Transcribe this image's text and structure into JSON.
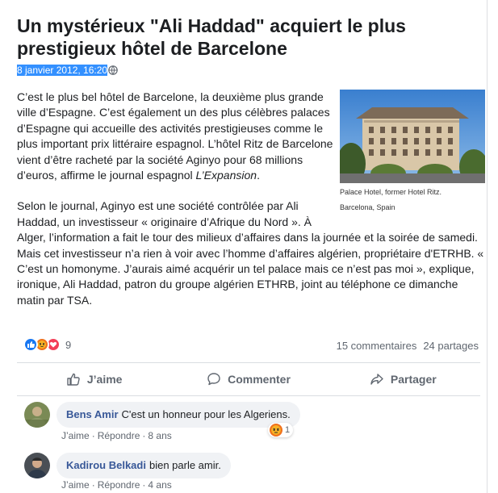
{
  "article": {
    "title": "Un mystérieux \"Ali Haddad\" acquiert le plus prestigieux hôtel de Barcelone",
    "date": "8 janvier 2012, 16:20",
    "paragraph1_a": "C’est le plus bel hôtel de Barcelone, la deuxième plus grande ville d’Espagne. C’est également un des plus célèbres palaces d’Espagne qui accueille des activités prestigieuses comme le plus important prix littéraire espagnol. L’hôtel Ritz de Barcelone vient d’être racheté par la société Aginyo pour 68 millions d’euros, affirme le journal espagnol ",
    "paragraph1_em": "L’Expansion",
    "paragraph1_b": ".",
    "paragraph2": "Selon le journal, Aginyo est une société contrôlée par Ali Haddad, un investisseur « originaire d’Afrique du Nord ». À Alger, l’information a fait le tour des milieux d’affaires dans la journée et la soirée de samedi. Mais cet investisseur n’a rien à voir avec l’homme d’affaires algérien, propriétaire d'ETRHB. « C’est un homonyme. J’aurais aimé acquérir un tel palace mais ce n’est pas moi », explique, ironique, Ali Haddad, patron du groupe algérien ETHRB, joint au téléphone ce dimanche matin par TSA.",
    "photo_caption_1": "Palace Hotel, former Hotel Ritz.",
    "photo_caption_2": "Barcelona, Spain"
  },
  "stats": {
    "reaction_count": "9",
    "comments": "15 commentaires",
    "shares": "24 partages",
    "reaction_icons": [
      "like-icon",
      "angry-icon",
      "love-icon"
    ]
  },
  "actions": {
    "like": "J’aime",
    "comment": "Commenter",
    "share": "Partager"
  },
  "comments": [
    {
      "author": "Bens Amir",
      "text": "C'est un honneur pour les Algeriens.",
      "like": "J’aime",
      "reply": "Répondre",
      "time": "8 ans",
      "reaction_count": "1"
    },
    {
      "author": "Kadirou Belkadi",
      "text": "bien parle amir.",
      "like": "J’aime",
      "reply": "Répondre",
      "time": "4 ans"
    }
  ],
  "colors": {
    "accent": "#385898",
    "like_blue": "#1877f2",
    "angry_orange": "#f0711d",
    "love_red": "#f33e58",
    "muted": "#606770",
    "selection": "#3390ff"
  }
}
